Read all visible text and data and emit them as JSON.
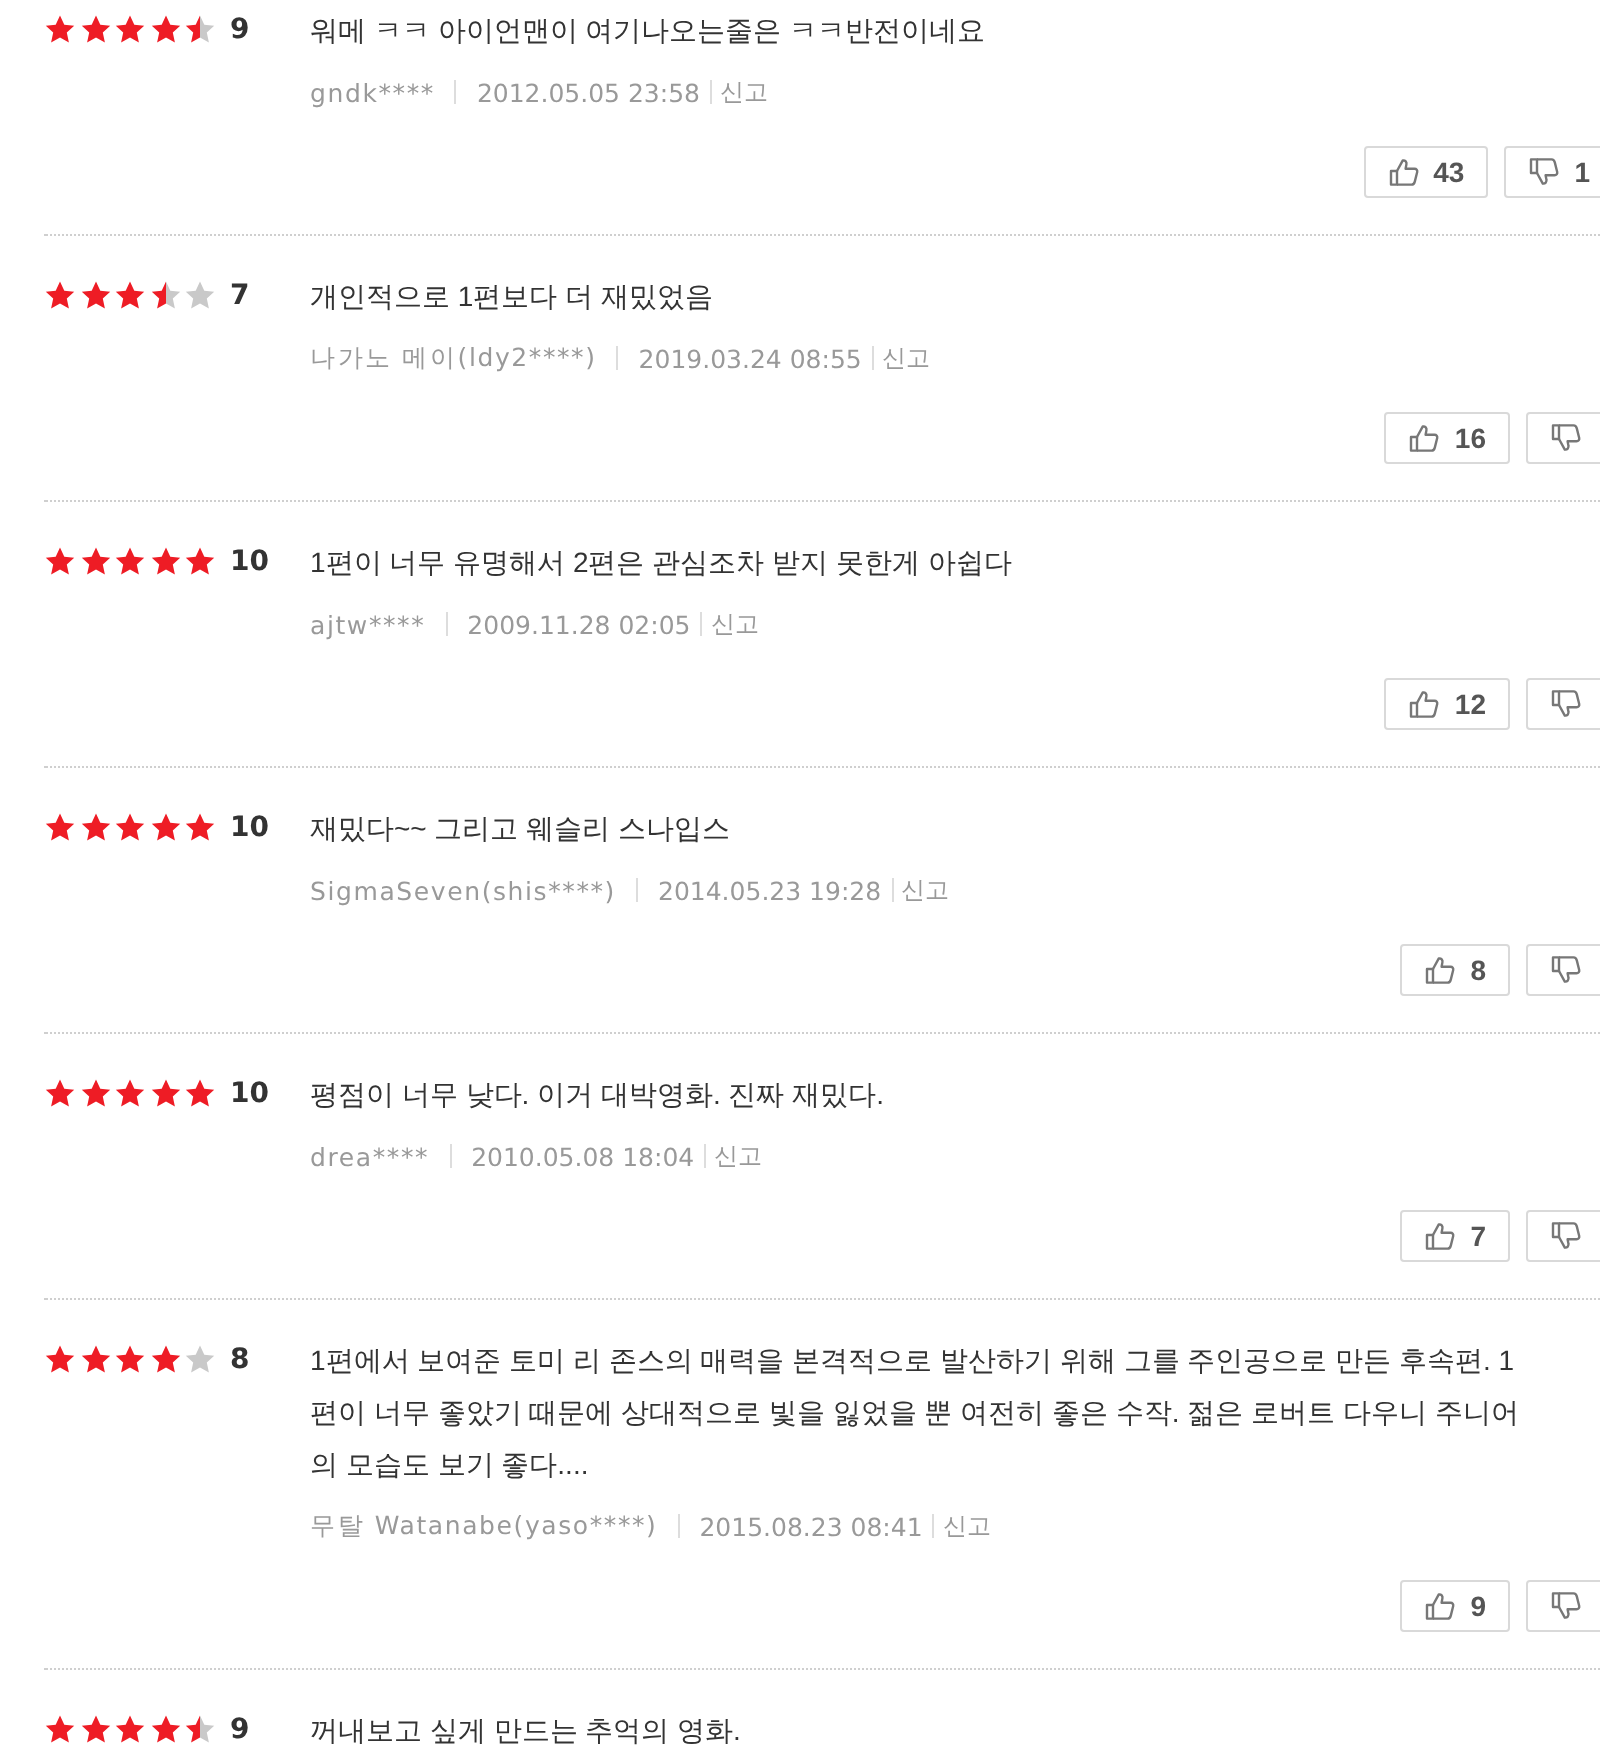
{
  "reviews": [
    {
      "stars": 4.5,
      "score": "9",
      "text": "워메 ㅋㅋ 아이언맨이 여기나오는줄은 ㅋㅋ반전이네요",
      "author": "gndk****",
      "date": "2012.05.05 23:58",
      "report": "신고",
      "likes": "43",
      "dislikes": "1"
    },
    {
      "stars": 3.5,
      "score": "7",
      "text": "개인적으로 1편보다 더 재밌었음",
      "author": "나가노 메이(ldy2****)",
      "date": "2019.03.24 08:55",
      "report": "신고",
      "likes": "16"
    },
    {
      "stars": 5,
      "score": "10",
      "text": "1편이 너무 유명해서 2편은 관심조차 받지 못한게 아쉽다",
      "author": "ajtw****",
      "date": "2009.11.28 02:05",
      "report": "신고",
      "likes": "12"
    },
    {
      "stars": 5,
      "score": "10",
      "text": "재밌다~~ 그리고 웨슬리 스나입스",
      "author": "SigmaSeven(shis****)",
      "date": "2014.05.23 19:28",
      "report": "신고",
      "likes": "8"
    },
    {
      "stars": 5,
      "score": "10",
      "text": "평점이 너무 낮다. 이거 대박영화. 진짜 재밌다.",
      "author": "drea****",
      "date": "2010.05.08 18:04",
      "report": "신고",
      "likes": "7"
    },
    {
      "stars": 4,
      "score": "8",
      "text": "1편에서 보여준 토미 리 존스의 매력을 본격적으로 발산하기 위해 그를 주인공으로 만든 후속편. 1편이 너무 좋았기 때문에 상대적으로 빛을 잃었을 뿐 여전히 좋은 수작. 젊은 로버트 다우니 주니어의 모습도 보기 좋다....",
      "author": "무탈 Watanabe(yaso****)",
      "date": "2015.08.23 08:41",
      "report": "신고",
      "likes": "9"
    },
    {
      "stars": 4.5,
      "score": "9",
      "text": "꺼내보고 싶게 만드는 추억의 영화."
    }
  ]
}
